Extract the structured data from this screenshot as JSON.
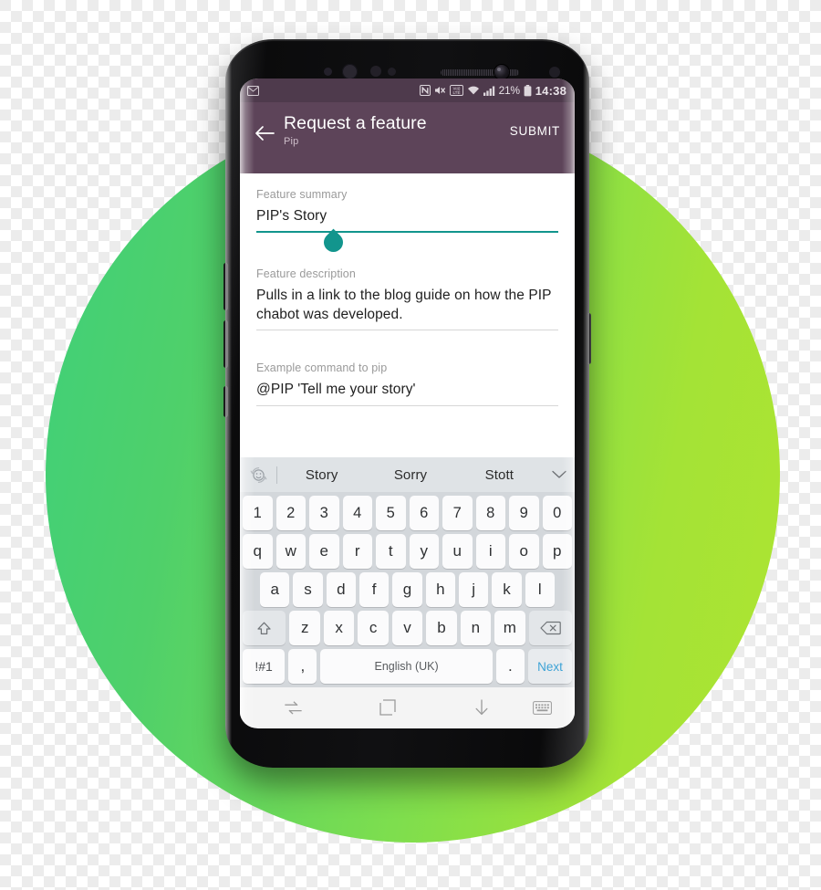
{
  "background": {
    "shape": "circle",
    "gradient_from": "#3fd07a",
    "gradient_to": "#aee431"
  },
  "device": {
    "name": "android-phone",
    "hardware": [
      "proximity-sensor",
      "front-camera",
      "earpiece-speaker",
      "iris-scanner"
    ]
  },
  "statusbar": {
    "notification_icon": "mail-icon",
    "icons": [
      "nfc-icon",
      "mute-icon",
      "volte-icon",
      "wifi-icon",
      "signal-icon"
    ],
    "battery_percent": "21%",
    "battery_icon": "battery-icon",
    "time": "14:38",
    "bg": "#4e3a4c"
  },
  "appbar": {
    "back_icon": "back-arrow-icon",
    "title": "Request a feature",
    "subtitle": "Pip",
    "submit_label": "SUBMIT",
    "bg": "#5d4459"
  },
  "form": {
    "accent": "#12958d",
    "fields": [
      {
        "label": "Feature summary",
        "value": "PIP's Story",
        "focused": true,
        "handle": "text-select-handle"
      },
      {
        "label": "Feature description",
        "value": "Pulls in a link to the blog guide on how the PIP chabot was developed.",
        "focused": false
      },
      {
        "label": "Example command to pip",
        "value": "@PIP 'Tell me your story'",
        "focused": false
      }
    ]
  },
  "keyboard": {
    "emoji_icon": "emoji-rotate-icon",
    "expand_icon": "chevron-down-icon",
    "suggestions": [
      "Story",
      "Sorry",
      "Stott"
    ],
    "row_numbers": [
      "1",
      "2",
      "3",
      "4",
      "5",
      "6",
      "7",
      "8",
      "9",
      "0"
    ],
    "row_top": [
      "q",
      "w",
      "e",
      "r",
      "t",
      "y",
      "u",
      "i",
      "o",
      "p"
    ],
    "row_home": [
      "a",
      "s",
      "d",
      "f",
      "g",
      "h",
      "j",
      "k",
      "l"
    ],
    "row_bottom": [
      "z",
      "x",
      "c",
      "v",
      "b",
      "n",
      "m"
    ],
    "shift_icon": "shift-icon",
    "backspace_icon": "backspace-icon",
    "symbols_label": "!#1",
    "comma_label": ",",
    "space_label": "English (UK)",
    "period_label": ".",
    "next_label": "Next",
    "bg": "#d3d7db",
    "key_bg": "#fbfbfc",
    "next_color": "#3da3d6"
  },
  "navbar": {
    "recents_icon": "recents-icon",
    "home_icon": "home-icon",
    "hide_keyboard_icon": "down-arrow-icon",
    "keyboard_icon": "keyboard-icon",
    "bg": "#f4f4f4"
  }
}
